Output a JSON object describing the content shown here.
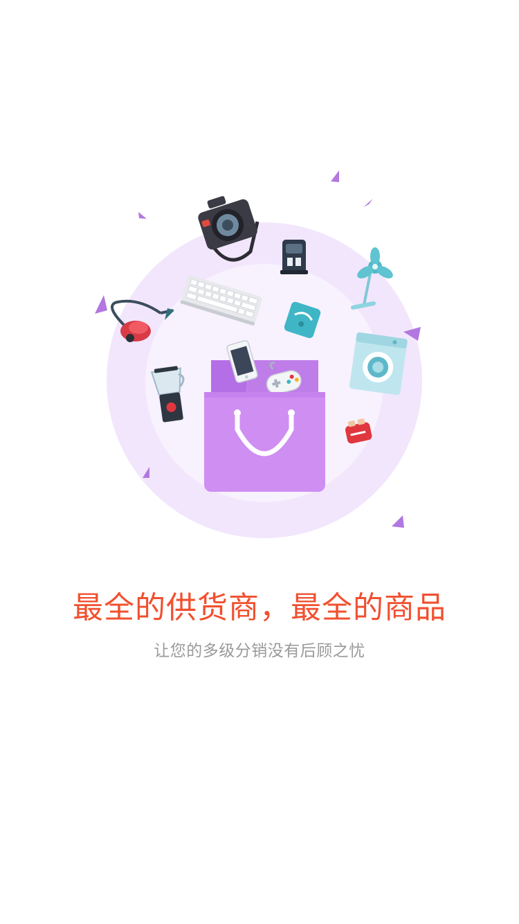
{
  "onboarding": {
    "headline": "最全的供货商，最全的商品",
    "subtitle": "让您的多级分销没有后顾之忧"
  },
  "colors": {
    "accent": "#f1502f",
    "subtitle": "#9a9a9a",
    "circle_outer": "#f2e6fc",
    "circle_inner": "#f8f1fe",
    "bag": "#cf8ef2",
    "confetti": "#b277e0"
  },
  "illustration": {
    "icons": [
      "camera-icon",
      "coffee-machine-icon",
      "fan-icon",
      "keyboard-icon",
      "vacuum-cleaner-icon",
      "scale-icon",
      "washing-machine-icon",
      "smartphone-icon",
      "game-controller-icon",
      "blender-icon",
      "toaster-icon",
      "shopping-bag-icon"
    ]
  }
}
